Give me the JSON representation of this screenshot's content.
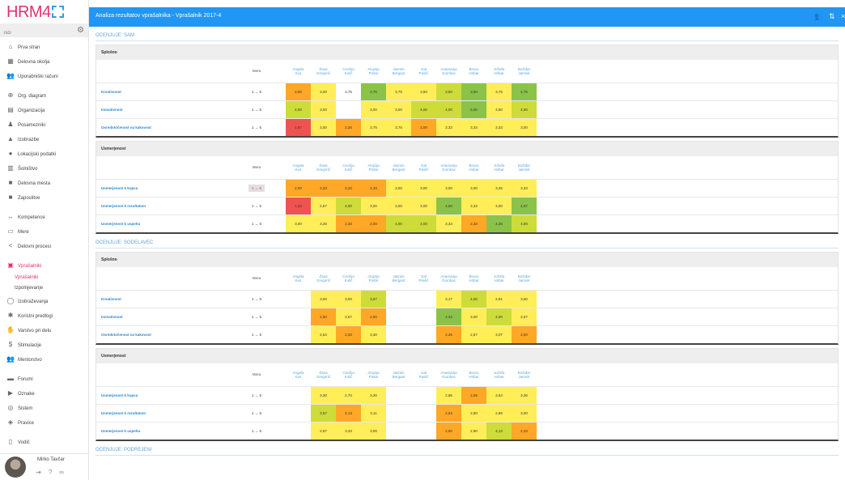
{
  "app": {
    "logo_text": "HRM4"
  },
  "sidebar": {
    "search_placeholder": "išči",
    "items": [
      {
        "label": "Prva stran",
        "icon": "home-icon",
        "glyph": "⌂",
        "gap": false
      },
      {
        "label": "Delovna okolja",
        "icon": "workspace-icon",
        "glyph": "▦",
        "gap": false
      },
      {
        "label": "Uporabniški računi",
        "icon": "users-icon",
        "glyph": "👥",
        "gap": false
      },
      {
        "label": "Org. diagram",
        "icon": "org-diagram-icon",
        "glyph": "⊕",
        "gap": true
      },
      {
        "label": "Organizacija",
        "icon": "organization-icon",
        "glyph": "▤",
        "gap": false
      },
      {
        "label": "Posamezniki",
        "icon": "person-icon",
        "glyph": "♟",
        "gap": false
      },
      {
        "label": "Izobrazbe",
        "icon": "graduation-icon",
        "glyph": "▲",
        "gap": false
      },
      {
        "label": "Lokacijski podatki",
        "icon": "location-icon",
        "glyph": "●",
        "gap": false
      },
      {
        "label": "Šolništvo",
        "icon": "school-icon",
        "glyph": "▥",
        "gap": false
      },
      {
        "label": "Delovna mesta",
        "icon": "briefcase-icon",
        "glyph": "■",
        "gap": false
      },
      {
        "label": "Zaposlitve",
        "icon": "employment-icon",
        "glyph": "■",
        "gap": false
      },
      {
        "label": "Kompetence",
        "icon": "competence-icon",
        "glyph": "↔",
        "gap": true
      },
      {
        "label": "Mere",
        "icon": "ruler-icon",
        "glyph": "▭",
        "gap": false
      },
      {
        "label": "Delovni procesi",
        "icon": "share-icon",
        "glyph": "<",
        "gap": false
      },
      {
        "label": "Vprašalniki",
        "icon": "survey-icon",
        "glyph": "▣",
        "gap": true,
        "active": true
      },
      {
        "label": "Vprašalniki",
        "icon": "",
        "glyph": "",
        "sub": true,
        "active": true
      },
      {
        "label": "Izpolnjevanje",
        "icon": "",
        "glyph": "",
        "sub": true
      },
      {
        "label": "Izobraževanja",
        "icon": "training-icon",
        "glyph": "◯",
        "gap": false
      },
      {
        "label": "Koristni predlogi",
        "icon": "suggestion-icon",
        "glyph": "✱",
        "gap": false
      },
      {
        "label": "Varstvo pri delu",
        "icon": "hand-icon",
        "glyph": "✋",
        "gap": false
      },
      {
        "label": "Stimulacije",
        "icon": "dollar-icon",
        "glyph": "$",
        "gap": false
      },
      {
        "label": "Mentorstvo",
        "icon": "mentor-icon",
        "glyph": "👥",
        "gap": false
      },
      {
        "label": "Forumi",
        "icon": "forum-icon",
        "glyph": "▬",
        "gap": true
      },
      {
        "label": "Oznake",
        "icon": "tag-icon",
        "glyph": "▶",
        "gap": false
      },
      {
        "label": "Sistem",
        "icon": "system-icon",
        "glyph": "◎",
        "gap": false
      },
      {
        "label": "Pravice",
        "icon": "shield-icon",
        "glyph": "◈",
        "gap": false
      },
      {
        "label": "Vodič",
        "icon": "guide-icon",
        "glyph": "▯",
        "gap": true
      }
    ],
    "user_name": "Mirko Tavčar"
  },
  "topbar": {
    "title": "Analiza rezultatov vprašalnika - Vprašalnik 2017-4"
  },
  "colors": {
    "green": "#8bc34a",
    "lightgreen": "#cddc39",
    "yellow": "#ffee58",
    "orange": "#ffa726",
    "red": "#ef5350",
    "blue": "#2196f3",
    "pink": "#e0316f"
  },
  "sections": [
    {
      "title": "OCENJUJE: SAM",
      "cards": [
        {
          "title": "Splošno",
          "mera": "Mera",
          "people": [
            "Angela Kos",
            "Žana Gregorič",
            "Cecilija Količ",
            "Alojzija Pintar",
            "Jasmin Bergant",
            "Gal Pavlič",
            "Anamarija Gombac",
            "Bruno Hribar",
            "Jožefa Hribar",
            "Božidar Jamnik"
          ],
          "rows": [
            {
              "label": "Kreativnost",
              "range": "1 → 5",
              "cells": [
                [
                  "3,00",
                  "o"
                ],
                [
                  "3,00",
                  "y"
                ],
                [
                  "3,75",
                  "w"
                ],
                [
                  "4,75",
                  "g"
                ],
                [
                  "3,75",
                  "y"
                ],
                [
                  "3,50",
                  "y"
                ],
                [
                  "3,50",
                  "lg"
                ],
                [
                  "3,50",
                  "g"
                ],
                [
                  "3,75",
                  "y"
                ],
                [
                  "4,75",
                  "g"
                ]
              ]
            },
            {
              "label": "Inovativnost",
              "range": "1 → 5",
              "cells": [
                [
                  "4,00",
                  "lg"
                ],
                [
                  "3,00",
                  "y"
                ],
                [
                  "",
                  "w"
                ],
                [
                  "3,00",
                  "y"
                ],
                [
                  "3,00",
                  "y"
                ],
                [
                  "4,00",
                  "lg"
                ],
                [
                  "4,00",
                  "lg"
                ],
                [
                  "5,00",
                  "g"
                ],
                [
                  "3,50",
                  "y"
                ],
                [
                  "4,00",
                  "lg"
                ]
              ]
            },
            {
              "label": "Osredotočenost na kakovost",
              "range": "1 → 5",
              "cells": [
                [
                  "1,67",
                  "r"
                ],
                [
                  "3,00",
                  "y"
                ],
                [
                  "2,25",
                  "o"
                ],
                [
                  "3,75",
                  "y"
                ],
                [
                  "3,75",
                  "y"
                ],
                [
                  "2,00",
                  "o"
                ],
                [
                  "3,33",
                  "y"
                ],
                [
                  "3,33",
                  "y"
                ],
                [
                  "3,33",
                  "y"
                ],
                [
                  "3,00",
                  "y"
                ]
              ]
            }
          ]
        },
        {
          "title": "Usmerjenost",
          "mera": "Mera",
          "people": [
            "Angela Kos",
            "Žana Gregorič",
            "Cecilija Količ",
            "Alojzija Pintar",
            "Jasmin Bergant",
            "Gal Pavlič",
            "Anamarija Gombac",
            "Bruno Hribar",
            "Jožefa Hribar",
            "Božidar Jamnik"
          ],
          "rows": [
            {
              "label": "Usmerjenost k kupcu",
              "range": "1 → 5",
              "highlight": true,
              "cells": [
                [
                  "2,00",
                  "o"
                ],
                [
                  "2,33",
                  "o"
                ],
                [
                  "2,33",
                  "o"
                ],
                [
                  "2,33",
                  "o"
                ],
                [
                  "3,00",
                  "y"
                ],
                [
                  "3,00",
                  "y"
                ],
                [
                  "3,00",
                  "y"
                ],
                [
                  "3,00",
                  "y"
                ],
                [
                  "3,25",
                  "y"
                ],
                [
                  "3,33",
                  "y"
                ]
              ]
            },
            {
              "label": "Usmerjenost k rezultatom",
              "range": "1 → 5",
              "cells": [
                [
                  "1,33",
                  "r"
                ],
                [
                  "2,67",
                  "y"
                ],
                [
                  "4,00",
                  "lg"
                ],
                [
                  "3,00",
                  "y"
                ],
                [
                  "3,00",
                  "y"
                ],
                [
                  "3,00",
                  "y"
                ],
                [
                  "4,50",
                  "g"
                ],
                [
                  "3,33",
                  "y"
                ],
                [
                  "3,00",
                  "y"
                ],
                [
                  "4,67",
                  "g"
                ]
              ]
            },
            {
              "label": "Usmerjenost k uspehu",
              "range": "1 → 5",
              "cells": [
                [
                  "3,00",
                  "y"
                ],
                [
                  "3,25",
                  "y"
                ],
                [
                  "2,33",
                  "o"
                ],
                [
                  "2,00",
                  "o"
                ],
                [
                  "4,00",
                  "lg"
                ],
                [
                  "4,00",
                  "lg"
                ],
                [
                  "3,33",
                  "y"
                ],
                [
                  "2,33",
                  "o"
                ],
                [
                  "4,25",
                  "g"
                ],
                [
                  "4,00",
                  "lg"
                ]
              ]
            }
          ]
        }
      ]
    },
    {
      "title": "OCENJUJE: SODELAVEC",
      "cards": [
        {
          "title": "Splošno",
          "mera": "Mera",
          "people": [
            "Angela Kos",
            "Žana Gregorič",
            "Cecilija Količ",
            "Alojzija Pintar",
            "Jasmin Bergant",
            "Gal Pavlič",
            "Anamarija Gombac",
            "Bruno Hribar",
            "Jožefa Hribar",
            "Božidar Jamnik"
          ],
          "rows": [
            {
              "label": "Kreativnost",
              "range": "1 → 5",
              "cells": [
                [
                  "",
                  "w"
                ],
                [
                  "3,00",
                  "y"
                ],
                [
                  "3,00",
                  "y"
                ],
                [
                  "3,67",
                  "lg"
                ],
                [
                  "",
                  "w"
                ],
                [
                  "",
                  "w"
                ],
                [
                  "3,17",
                  "y"
                ],
                [
                  "4,00",
                  "lg"
                ],
                [
                  "2,91",
                  "y"
                ],
                [
                  "3,60",
                  "y"
                ]
              ]
            },
            {
              "label": "Inovativnost",
              "range": "1 → 5",
              "cells": [
                [
                  "",
                  "w"
                ],
                [
                  "2,50",
                  "o"
                ],
                [
                  "2,67",
                  "y"
                ],
                [
                  "2,00",
                  "o"
                ],
                [
                  "",
                  "w"
                ],
                [
                  "",
                  "w"
                ],
                [
                  "4,33",
                  "g"
                ],
                [
                  "3,00",
                  "y"
                ],
                [
                  "4,00",
                  "lg"
                ],
                [
                  "2,67",
                  "y"
                ]
              ]
            },
            {
              "label": "Osredotočenost na kakovost",
              "range": "1 → 5",
              "cells": [
                [
                  "",
                  "w"
                ],
                [
                  "2,64",
                  "y"
                ],
                [
                  "2,33",
                  "o"
                ],
                [
                  "3,30",
                  "y"
                ],
                [
                  "",
                  "w"
                ],
                [
                  "",
                  "w"
                ],
                [
                  "2,25",
                  "o"
                ],
                [
                  "2,67",
                  "y"
                ],
                [
                  "3,07",
                  "y"
                ],
                [
                  "2,00",
                  "o"
                ]
              ]
            }
          ]
        },
        {
          "title": "Usmerjenost",
          "mera": "Mera",
          "people": [
            "Angela Kos",
            "Žana Gregorič",
            "Cecilija Količ",
            "Alojzija Pintar",
            "Jasmin Bergant",
            "Gal Pavlič",
            "Anamarija Gombac",
            "Bruno Hribar",
            "Jožefa Hribar",
            "Božidar Jamnik"
          ],
          "rows": [
            {
              "label": "Usmerjenost k kupcu",
              "range": "1 → 5",
              "cells": [
                [
                  "",
                  "w"
                ],
                [
                  "3,30",
                  "y"
                ],
                [
                  "2,70",
                  "y"
                ],
                [
                  "3,30",
                  "y"
                ],
                [
                  "",
                  "w"
                ],
                [
                  "",
                  "w"
                ],
                [
                  "2,95",
                  "y"
                ],
                [
                  "2,55",
                  "o"
                ],
                [
                  "2,64",
                  "y"
                ],
                [
                  "3,36",
                  "y"
                ]
              ]
            },
            {
              "label": "Usmerjenost k rezultatom",
              "range": "1 → 5",
              "cells": [
                [
                  "",
                  "w"
                ],
                [
                  "3,67",
                  "lg"
                ],
                [
                  "2,13",
                  "o"
                ],
                [
                  "3,11",
                  "y"
                ],
                [
                  "",
                  "w"
                ],
                [
                  "",
                  "w"
                ],
                [
                  "2,94",
                  "o"
                ],
                [
                  "2,80",
                  "y"
                ],
                [
                  "2,89",
                  "y"
                ],
                [
                  "3,00",
                  "y"
                ]
              ]
            },
            {
              "label": "Usmerjenost k uspehu",
              "range": "1 → 5",
              "cells": [
                [
                  "",
                  "w"
                ],
                [
                  "2,87",
                  "y"
                ],
                [
                  "3,33",
                  "y"
                ],
                [
                  "3,00",
                  "y"
                ],
                [
                  "",
                  "w"
                ],
                [
                  "",
                  "w"
                ],
                [
                  "2,50",
                  "o"
                ],
                [
                  "2,90",
                  "y"
                ],
                [
                  "4,13",
                  "lg"
                ],
                [
                  "2,33",
                  "o"
                ]
              ]
            }
          ]
        }
      ]
    },
    {
      "title": "OCENJUJE: PODREJENI",
      "cards": []
    }
  ]
}
